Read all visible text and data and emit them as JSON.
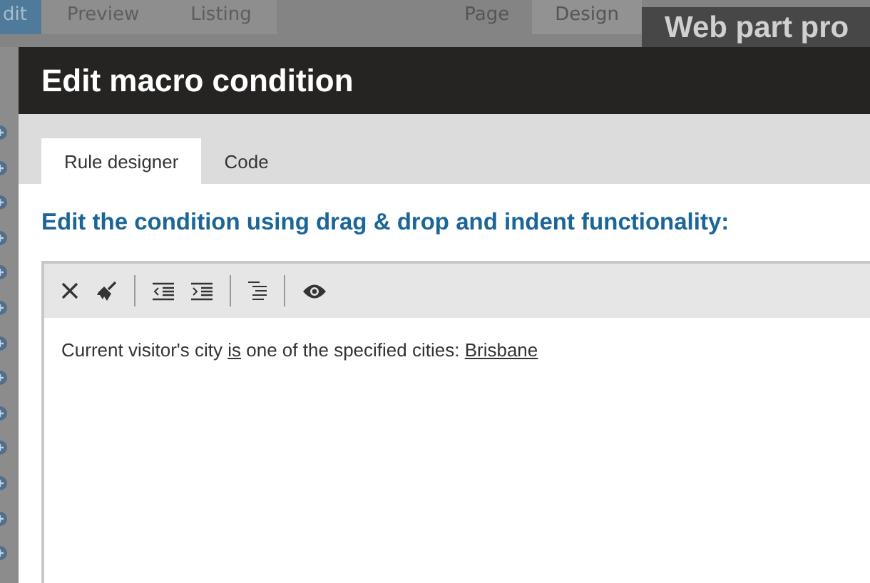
{
  "background": {
    "mode_tabs": [
      {
        "label": "dit",
        "selected": true
      },
      {
        "label": "Preview",
        "selected": false
      },
      {
        "label": "Listing",
        "selected": false
      }
    ],
    "view_tabs": [
      {
        "label": "Page",
        "selected": false
      },
      {
        "label": "Design",
        "selected": true
      }
    ]
  },
  "back_dialog": {
    "title": "Web part pro"
  },
  "dialog": {
    "title": "Edit macro condition",
    "tabs": [
      {
        "label": "Rule designer",
        "selected": true
      },
      {
        "label": "Code",
        "selected": false
      }
    ],
    "heading": "Edit the condition using drag & drop and indent functionality:",
    "rule": [
      {
        "kind": "text",
        "text": "Current visitor's city "
      },
      {
        "kind": "link",
        "text": "is"
      },
      {
        "kind": "text",
        "text": " one of the specified cities: "
      },
      {
        "kind": "link",
        "text": "Brisbane"
      }
    ]
  }
}
